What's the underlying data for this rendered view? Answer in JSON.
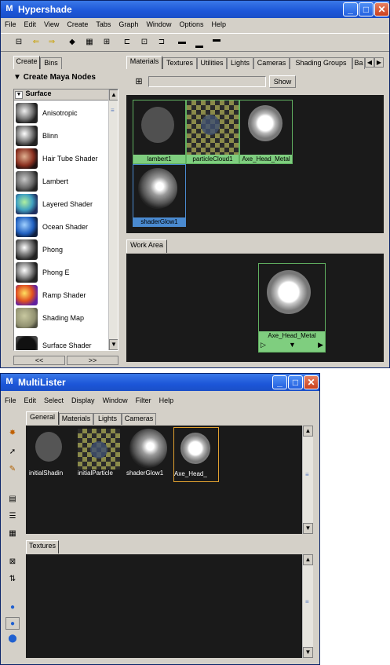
{
  "hypershade": {
    "title": "Hypershade",
    "menus": [
      "File",
      "Edit",
      "View",
      "Create",
      "Tabs",
      "Graph",
      "Window",
      "Options",
      "Help"
    ],
    "left_tabs": [
      "Create",
      "Bins"
    ],
    "create_header": "Create Maya Nodes",
    "category": "Surface",
    "nodes": [
      "Anisotropic",
      "Blinn",
      "Hair Tube Shader",
      "Lambert",
      "Layered Shader",
      "Ocean Shader",
      "Phong",
      "Phong E",
      "Ramp Shader",
      "Shading Map",
      "Surface Shader"
    ],
    "scroll_left": "<<",
    "scroll_right": ">>",
    "top_tabs": [
      "Materials",
      "Textures",
      "Utilities",
      "Lights",
      "Cameras",
      "Shading Groups",
      "Ba"
    ],
    "show_button": "Show",
    "materials": [
      "lambert1",
      "particleCloud1",
      "Axe_Head_Metal",
      "shaderGlow1"
    ],
    "work_area_tab": "Work Area",
    "work_node_label": "Axe_Head_Metal"
  },
  "multilister": {
    "title": "MultiLister",
    "menus": [
      "File",
      "Edit",
      "Select",
      "Display",
      "Window",
      "Filter",
      "Help"
    ],
    "tabs": [
      "General",
      "Materials",
      "Lights",
      "Cameras"
    ],
    "swatches": [
      "initialShadin",
      "initialParticle",
      "shaderGlow1",
      "Axe_Head_"
    ],
    "textures_tab": "Textures"
  }
}
